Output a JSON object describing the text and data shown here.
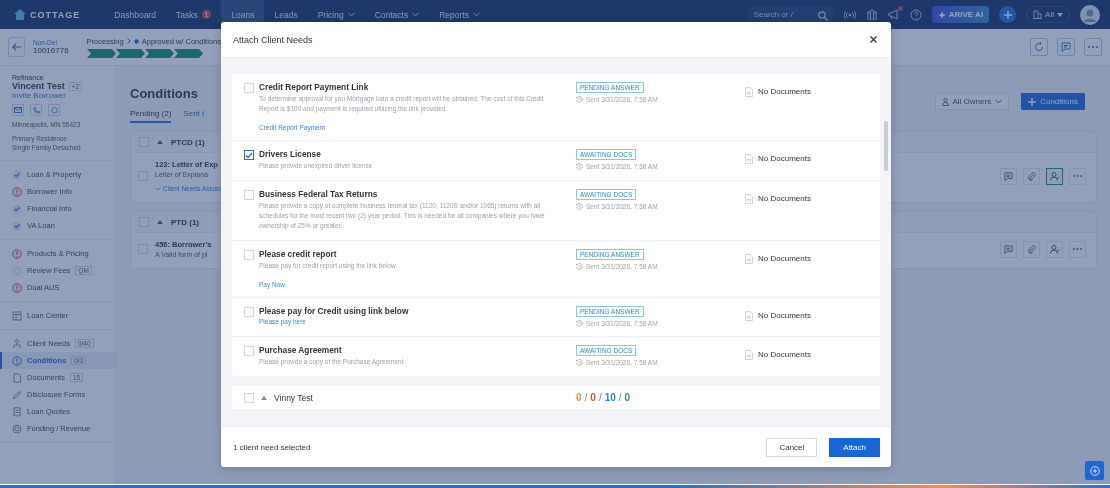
{
  "nav": {
    "logo": "COTTAGE",
    "items": [
      {
        "label": "Dashboard",
        "selected": false,
        "dropdown": false
      },
      {
        "label": "Tasks",
        "badge": "1",
        "selected": false,
        "dropdown": false
      },
      {
        "label": "Loans",
        "selected": true,
        "dropdown": false
      },
      {
        "label": "Leads",
        "selected": false,
        "dropdown": false
      },
      {
        "label": "Pricing",
        "selected": false,
        "dropdown": true
      },
      {
        "label": "Contacts",
        "selected": false,
        "dropdown": true
      },
      {
        "label": "Reports",
        "selected": false,
        "dropdown": true
      }
    ],
    "search": {
      "placeholder": "Search or /"
    },
    "ai_button": "ARIVE AI",
    "scope": "All"
  },
  "loan_header": {
    "tag": "Non-Del",
    "number": "10016776",
    "stage": "Processing",
    "status": "Approved w/ Conditions",
    "steps": [
      {
        "done": true
      },
      {
        "done": true
      },
      {
        "done": true
      },
      {
        "done": true
      }
    ]
  },
  "sidebar": {
    "loan_type": "Refinance",
    "borrower": "Vincent Test",
    "co_borrowers": "+2",
    "invite": "Invite Borrower",
    "address": "Minneapolis, MN 55423",
    "occupancy": "Primary Residence",
    "property_type": "Single Family Detached",
    "sections": [
      [
        {
          "label": "Loan & Property",
          "kind": "complete",
          "selected": false
        },
        {
          "label": "Borrower Info",
          "kind": "alert",
          "selected": false
        },
        {
          "label": "Financial Info",
          "kind": "complete",
          "selected": false
        },
        {
          "label": "VA Loan",
          "kind": "complete",
          "selected": false
        }
      ],
      [
        {
          "label": "Products & Pricing",
          "kind": "alert",
          "selected": false
        },
        {
          "label": "Review Fees",
          "kind": "pending",
          "badge": "QM",
          "selected": false
        },
        {
          "label": "Dual AUS",
          "kind": "alert",
          "selected": false
        }
      ],
      [
        {
          "label": "Loan Center",
          "kind": "icon",
          "selected": false
        }
      ],
      [
        {
          "label": "Client Needs",
          "kind": "icon",
          "badge": "0/40",
          "selected": false
        },
        {
          "label": "Conditions",
          "kind": "icon",
          "badge": "0/3",
          "selected": true
        },
        {
          "label": "Documents",
          "kind": "icon",
          "badge": "15",
          "selected": false
        },
        {
          "label": "Disclosure Forms",
          "kind": "icon",
          "selected": false
        },
        {
          "label": "Loan Quotes",
          "kind": "icon",
          "selected": false
        },
        {
          "label": "Funding / Revenue",
          "kind": "icon",
          "selected": false
        }
      ]
    ]
  },
  "main": {
    "title": "Conditions",
    "tabs": [
      {
        "label": "Pending (2)",
        "selected": true
      },
      {
        "label": "Sent t",
        "selected": false
      }
    ],
    "owners": "All Owners",
    "add_button": "Conditions",
    "groups": [
      {
        "name": "PTCD (1)",
        "checked": false,
        "conditions": [
          {
            "title": "123: Letter of Exp",
            "description": "Letter of Explana",
            "link": "Client Needs Associ",
            "assigned": true,
            "checked": false
          }
        ]
      },
      {
        "name": "PTD (1)",
        "checked": false,
        "conditions": [
          {
            "title": "456: Borrower's",
            "description": "A Valid form of pl",
            "assigned": false,
            "checked": false
          }
        ]
      }
    ]
  },
  "modal": {
    "title": "Attach Client Needs",
    "needs": [
      {
        "title": "Credit Report Payment Link",
        "description": "To determine approval for you Mortgage loan a credit report will be obtained. The cost of this Credit Report is $100 and payment is required utilizing the link provided",
        "link": "Credit Report Payment",
        "status": "PENDING ANSWER",
        "sent": "Sent 3/31/2026, 7:58 AM",
        "documents": "No Documents",
        "checked": false
      },
      {
        "title": "Drivers License",
        "description": "Please provide unexpired driver license",
        "status": "AWAITING DOCS",
        "sent": "Sent 3/31/2026, 7:58 AM",
        "documents": "No Documents",
        "checked": true
      },
      {
        "title": "Business Federal Tax Returns",
        "description": "Please provide a copy of complete business federal tax (1120, 1120S and/or 1065) returns with all schedules for the most recent two (2) year period. This is needed for all companies where you have ownership of 25% or greater.",
        "status": "AWAITING DOCS",
        "sent": "Sent 3/31/2026, 7:58 AM",
        "documents": "No Documents",
        "checked": false
      },
      {
        "title": "Please credit report",
        "description": "Please pay for credit report using the link below",
        "link": "Pay Now",
        "status": "PENDING ANSWER",
        "sent": "Sent 3/31/2026, 7:58 AM",
        "documents": "No Documents",
        "checked": false
      },
      {
        "title": "Please pay for Credit using link below",
        "link": "Please pay here",
        "status": "PENDING ANSWER",
        "sent": "Sent 3/31/2026, 7:58 AM",
        "documents": "No Documents",
        "checked": false
      },
      {
        "title": "Purchase Agreement",
        "description": "Please provide a copy of the Purchase Agreement",
        "status": "AWAITING DOCS",
        "sent": "Sent 3/31/2026, 7:58 AM",
        "documents": "No Documents",
        "checked": false
      }
    ],
    "group": {
      "name": "Vinny Test",
      "checked": false,
      "separator": "/",
      "counts": [
        {
          "value": "0",
          "color": "#f08a3c"
        },
        {
          "value": "0",
          "color": "#e5484d"
        },
        {
          "value": "10",
          "color": "#1a8fd6"
        },
        {
          "value": "0",
          "color": "#2e9d5b"
        }
      ]
    },
    "footer": "1 client need selected",
    "cancel": "Cancel",
    "attach": "Attach"
  }
}
